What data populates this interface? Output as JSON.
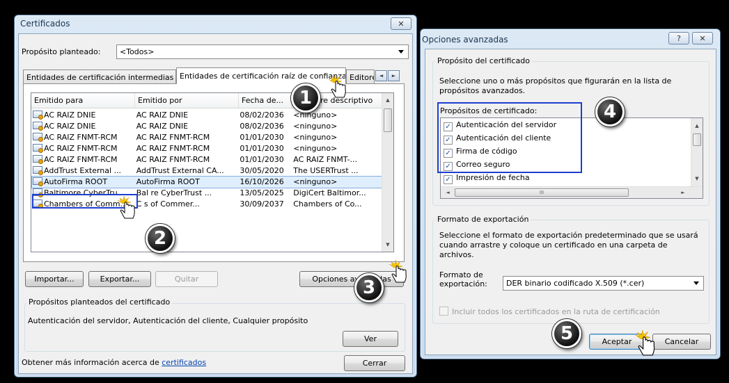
{
  "colors": {
    "highlight": "#1d3ed1",
    "selection": "#dfeefc",
    "link": "#0645ad"
  },
  "certificados": {
    "title": "Certificados",
    "close_label": "✕",
    "proposito_label": "Propósito planteado:",
    "proposito_value": "<Todos>",
    "tabs": [
      "Entidades de certificación intermedias",
      "Entidades de certificación raíz de confianza",
      "Editore"
    ],
    "tab_scroll": {
      "left": "◄",
      "right": "►"
    },
    "columns": [
      "Emitido para",
      "Emitido por",
      "Fecha de...",
      "re descriptivo"
    ],
    "rows": [
      [
        "AC RAIZ DNIE",
        "AC RAIZ DNIE",
        "08/02/2036",
        "<ninguno>"
      ],
      [
        "AC RAIZ DNIE",
        "AC RAIZ DNIE",
        "08/02/2036",
        "<ninguno>"
      ],
      [
        "AC RAIZ FNMT-RCM",
        "AC RAIZ FNMT-RCM",
        "01/01/2030",
        "<ninguno>"
      ],
      [
        "AC RAIZ FNMT-RCM",
        "AC RAIZ FNMT-RCM",
        "01/01/2030",
        "<ninguno>"
      ],
      [
        "AC RAIZ FNMT-RCM",
        "AC RAIZ FNMT-RCM",
        "01/01/2030",
        "AC RAIZ FNMT-..."
      ],
      [
        "AddTrust External ...",
        "AddTrust External CA...",
        "30/05/2020",
        "The USERTrust ..."
      ],
      [
        "AutoFirma ROOT",
        "AutoFirma ROOT",
        "16/10/2026",
        "<ninguno>"
      ],
      [
        "Baltimore CyberTru",
        "Bal    re CyberTrust ...",
        "13/05/2025",
        "DigiCert Baltimor..."
      ],
      [
        "Chambers of Comm...",
        "C     s of Commer...",
        "30/09/2037",
        "Chambers of Co..."
      ]
    ],
    "selected_row": 6,
    "buttons": {
      "importar": "Importar...",
      "exportar": "Exportar...",
      "quitar": "Quitar",
      "opciones": "Opciones avanzadas",
      "ver": "Ver",
      "cerrar": "Cerrar"
    },
    "group_title": "Propósitos planteados del certificado",
    "group_text": "Autenticación del servidor, Autenticación del cliente, Cualquier propósito",
    "footer_text": "Obtener más información acerca de ",
    "footer_link": "certificados"
  },
  "opciones": {
    "title": "Opciones avanzadas",
    "help_label": "?",
    "close_label": "✕",
    "group1_title": "Propósito del certificado",
    "group1_desc": "Seleccione uno o más propósitos que figurarán en la lista de propósitos avanzados.",
    "list_label": "Propósitos de certificado:",
    "purposes": [
      {
        "label": "Autenticación del servidor",
        "checked": "✓"
      },
      {
        "label": "Autenticación del cliente",
        "checked": "✓"
      },
      {
        "label": "Firma de código",
        "checked": "✓"
      },
      {
        "label": "Correo seguro",
        "checked": "✓"
      },
      {
        "label": "Impresión de fecha",
        "checked": "✓"
      }
    ],
    "hscroll_thumb": "III",
    "group2_title": "Formato de exportación",
    "group2_desc": "Seleccione el formato de exportación predeterminado que se usará cuando arrastre y coloque un certificado en una carpeta de archivos.",
    "format_label": "Formato de exportación:",
    "format_value": "DER binario codificado X.509 (*.cer)",
    "include_label": "Incluir todos los certificados en la ruta de certificación",
    "aceptar": "Aceptar",
    "cancelar": "Cancelar"
  },
  "badges": [
    "1",
    "2",
    "3",
    "4",
    "5"
  ],
  "icons": {
    "cursor": "hand-pointer-icon",
    "burst": "click-burst-icon",
    "certificate": "certificate-icon"
  }
}
